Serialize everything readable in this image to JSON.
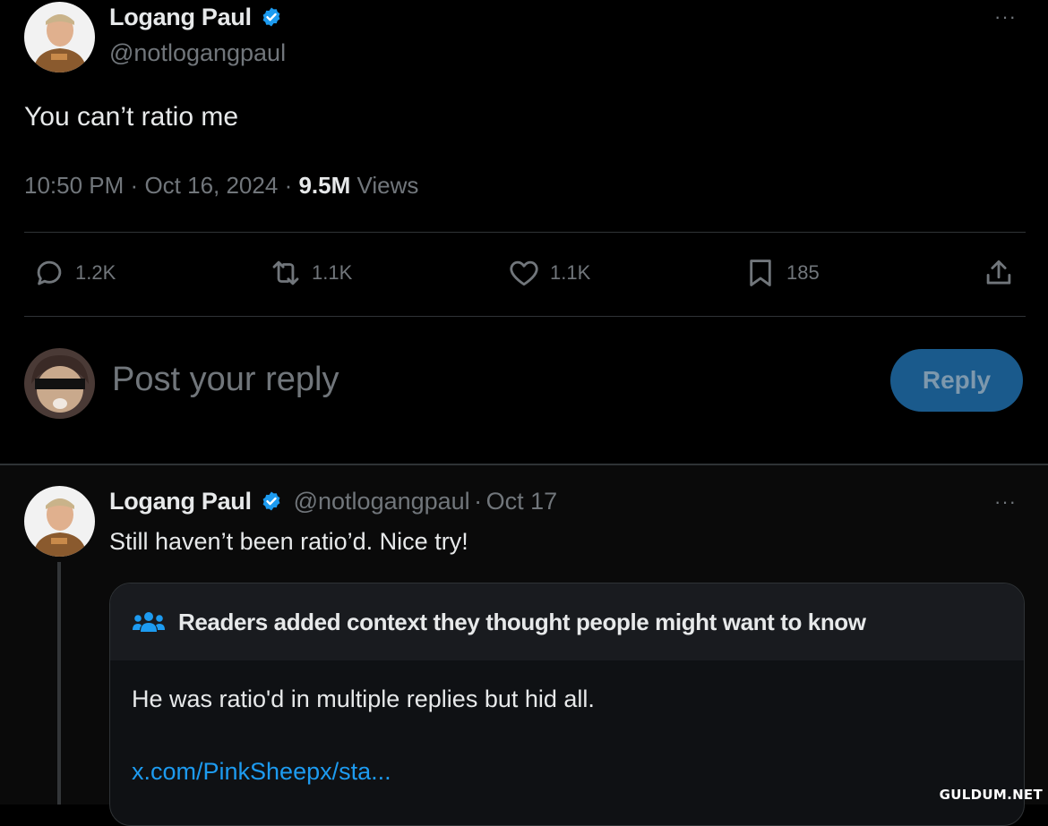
{
  "main_tweet": {
    "display_name": "Logang Paul",
    "handle": "@notlogangpaul",
    "text": "You can’t ratio me",
    "time": "10:50 PM",
    "date": "Oct 16, 2024",
    "views_count": "9.5M",
    "views_label": "Views",
    "separator": "·",
    "more": "···",
    "actions": {
      "replies": "1.2K",
      "reposts": "1.1K",
      "likes": "1.1K",
      "bookmarks": "185"
    }
  },
  "composer": {
    "placeholder": "Post your reply",
    "reply_label": "Reply"
  },
  "reply_tweet": {
    "display_name": "Logang Paul",
    "handle": "@notlogangpaul",
    "separator": "·",
    "date": "Oct 17",
    "text": "Still haven’t been ratio’d. Nice try!",
    "more": "···"
  },
  "community_note": {
    "header": "Readers added context they thought people might want to know",
    "body": "He was ratio'd in multiple replies but hid all.",
    "link": "x.com/PinkSheepx/sta..."
  },
  "watermark": "GULDUM.NET",
  "colors": {
    "background": "#000000",
    "text": "#e7e9ea",
    "muted": "#71767b",
    "verified": "#1d9bf0",
    "link": "#1d9bf0",
    "reply_button": "#1a5a8c"
  }
}
